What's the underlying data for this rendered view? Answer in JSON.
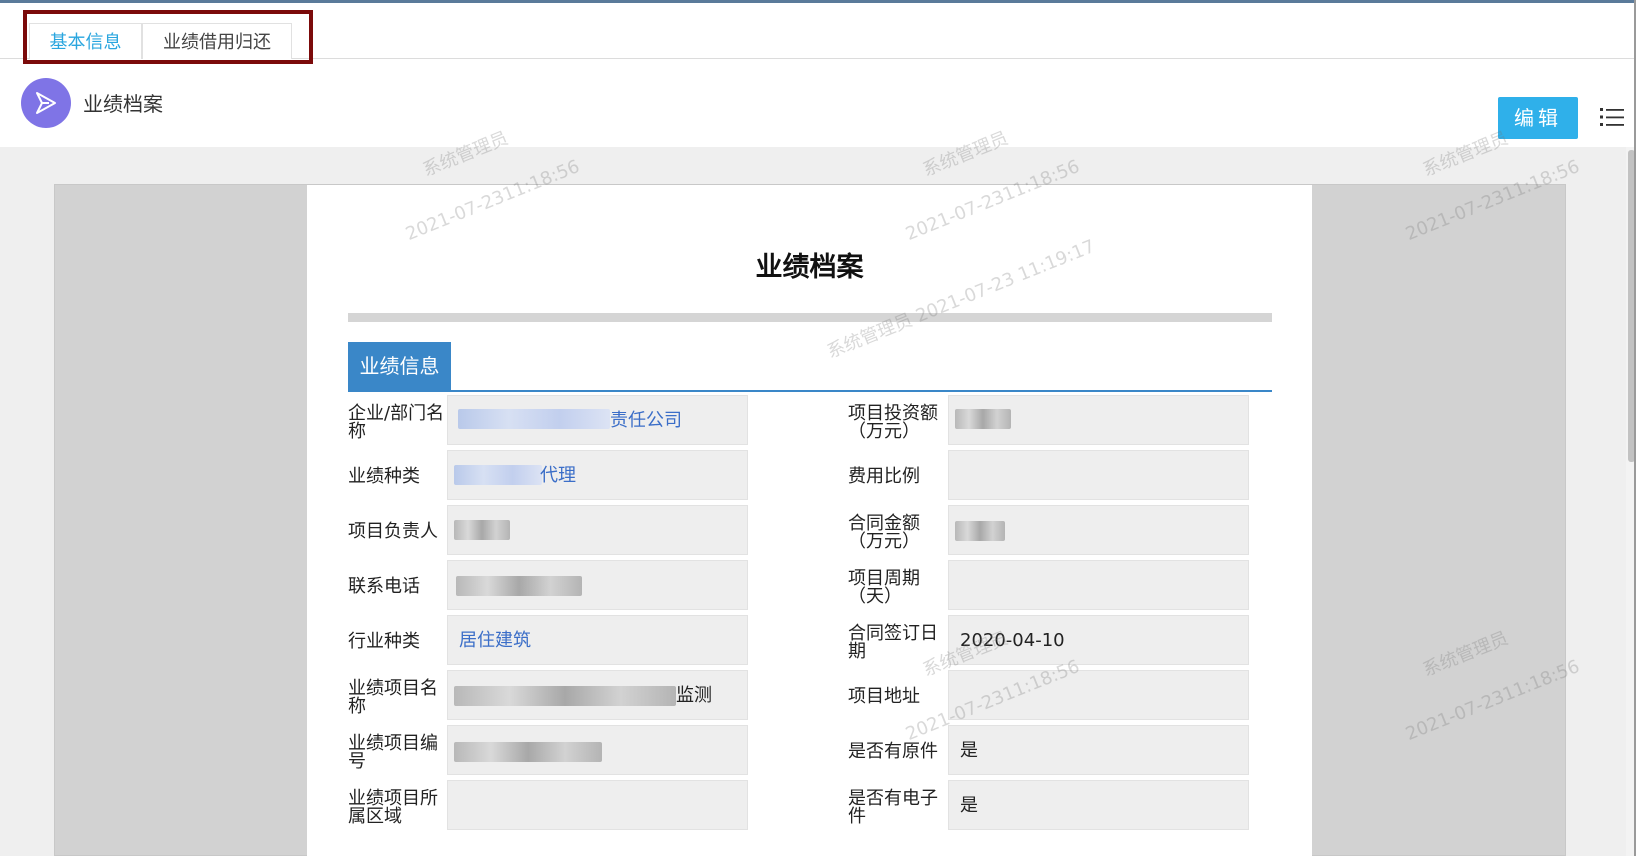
{
  "tabs": [
    {
      "label": "基本信息",
      "active": true
    },
    {
      "label": "业绩借用归还",
      "active": false
    }
  ],
  "header": {
    "title": "业绩档案",
    "edit_label": "编辑",
    "avatar_icon": "send-icon",
    "menu_icon": "list-icon"
  },
  "document": {
    "title": "业绩档案",
    "section_label": "业绩信息",
    "left_fields": [
      {
        "label_1": "企业/部门名",
        "label_2": "称",
        "value": "责任公司"
      },
      {
        "label_1": "业绩种类",
        "label_2": "",
        "value": "代理"
      },
      {
        "label_1": "项目负责人",
        "label_2": "",
        "value": ""
      },
      {
        "label_1": "联系电话",
        "label_2": "",
        "value": ""
      },
      {
        "label_1": "行业种类",
        "label_2": "",
        "value": "居住建筑"
      },
      {
        "label_1": "业绩项目名",
        "label_2": "称",
        "value": "监测"
      },
      {
        "label_1": "业绩项目编",
        "label_2": "号",
        "value": ""
      },
      {
        "label_1": "业绩项目所",
        "label_2": "属区域",
        "value": ""
      }
    ],
    "right_fields": [
      {
        "label_1": "项目投资额",
        "label_2": "（万元）",
        "value": ""
      },
      {
        "label_1": "费用比例",
        "label_2": "",
        "value": ""
      },
      {
        "label_1": "合同金额",
        "label_2": "（万元）",
        "value": ""
      },
      {
        "label_1": "项目周期",
        "label_2": "（天）",
        "value": ""
      },
      {
        "label_1": "合同签订日",
        "label_2": "期",
        "value": "2020-04-10"
      },
      {
        "label_1": "项目地址",
        "label_2": "",
        "value": ""
      },
      {
        "label_1": "是否有原件",
        "label_2": "",
        "value": "是"
      },
      {
        "label_1": "是否有电子",
        "label_2": "件",
        "value": "是"
      }
    ]
  },
  "watermarks": {
    "user": "系统管理员",
    "time_a": "2021-07-2311:18:56",
    "time_b": "2021-07-23 11:19:17"
  },
  "colors": {
    "accent": "#2fb0ea",
    "active_tab": "#2aa6df",
    "section": "#3a87c8",
    "highlight_border": "#7b0a0a",
    "avatar": "#7f74e6"
  }
}
